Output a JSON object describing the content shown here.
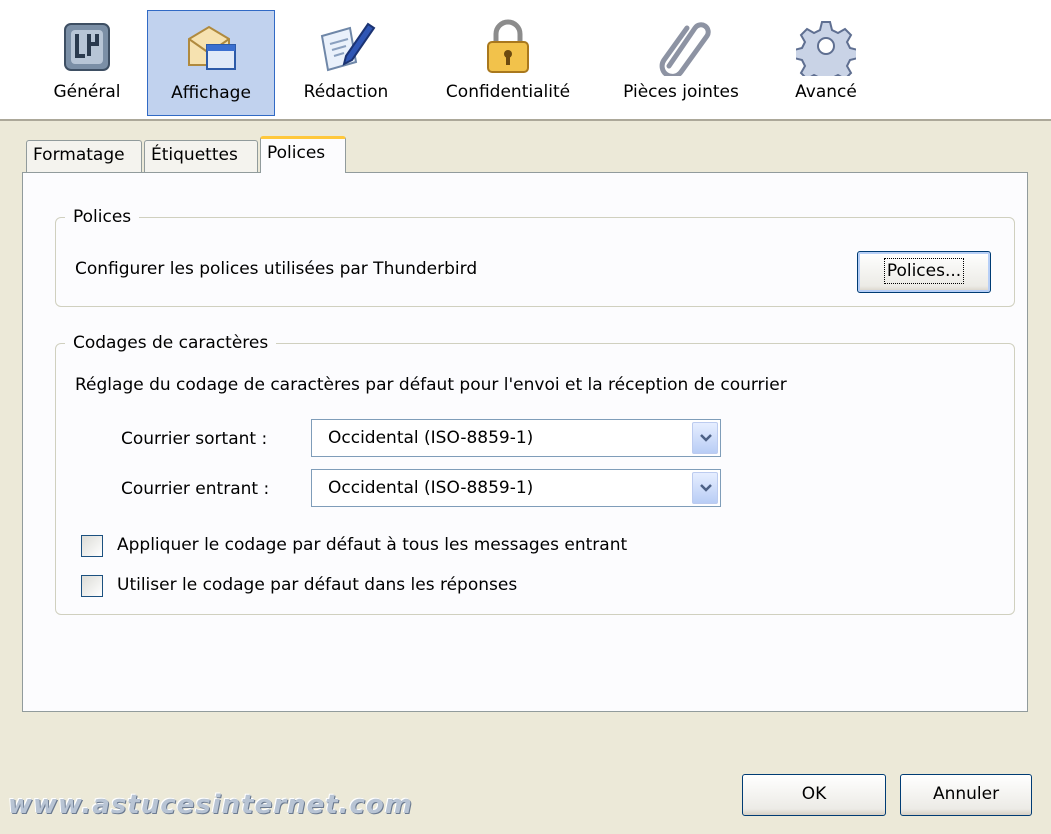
{
  "toolbar": {
    "items": [
      {
        "label": "Général",
        "icon": "general-icon"
      },
      {
        "label": "Affichage",
        "icon": "display-icon",
        "selected": true
      },
      {
        "label": "Rédaction",
        "icon": "compose-icon"
      },
      {
        "label": "Confidentialité",
        "icon": "lock-icon"
      },
      {
        "label": "Pièces jointes",
        "icon": "paperclip-icon"
      },
      {
        "label": "Avancé",
        "icon": "gear-icon"
      }
    ]
  },
  "tabs": [
    {
      "label": "Formatage"
    },
    {
      "label": "Étiquettes"
    },
    {
      "label": "Polices",
      "active": true
    }
  ],
  "fonts_group": {
    "legend": "Polices",
    "description": "Configurer les polices utilisées par Thunderbird",
    "button_label": "Polices..."
  },
  "encoding_group": {
    "legend": "Codages de caractères",
    "description": "Réglage du codage de caractères par défaut pour l'envoi et la réception de courrier",
    "outgoing_label": "Courrier sortant :",
    "outgoing_value": "Occidental (ISO-8859-1)",
    "incoming_label": "Courrier entrant :",
    "incoming_value": "Occidental (ISO-8859-1)",
    "apply_default_label": "Appliquer le codage par défaut à tous les messages entrant",
    "apply_default_checked": false,
    "use_default_reply_label": "Utiliser le codage par défaut dans les réponses",
    "use_default_reply_checked": false
  },
  "footer": {
    "ok_label": "OK",
    "cancel_label": "Annuler"
  },
  "watermark": "www.astucesinternet.com",
  "colors": {
    "selected_bg": "#c1d2ee",
    "selected_border": "#316ac5",
    "dialog_bg": "#ece9d8",
    "active_tab_accent": "#ffc83c"
  }
}
